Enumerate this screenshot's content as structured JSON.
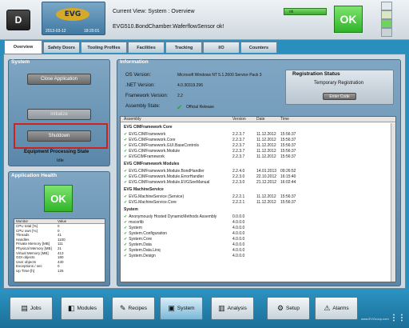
{
  "header": {
    "badge": "D",
    "logo_text": "EVG",
    "date": "2013-03-12",
    "time": "18:20:01",
    "current_view": "Current View: System : Overview",
    "status_message": "EVG510.BondChamber.WaferflowSensor ok!",
    "status_indicator": "ok",
    "ok_label": "OK",
    "colors": {
      "ok_green": "#3daa30",
      "accent_blue": "#2a8fbd"
    }
  },
  "tabs": [
    {
      "label": "Overview",
      "active": true
    },
    {
      "label": "Safety Doors"
    },
    {
      "label": "Tooling Profiles"
    },
    {
      "label": "Facilities"
    },
    {
      "label": "Tracking"
    },
    {
      "label": "I/O"
    },
    {
      "label": "Counters"
    }
  ],
  "system": {
    "title": "System",
    "close_app": "Close Application",
    "initialize": "Initialize",
    "shutdown": "Shutdown",
    "state_label": "Equipment Processing State",
    "state_value": "Idle"
  },
  "health": {
    "title": "Application Health",
    "ok_label": "OK",
    "table_headers": [
      "Monitor",
      "Value"
    ],
    "rows": [
      [
        "CPU total [%]",
        "0"
      ],
      [
        "CPU own [%]",
        "0"
      ],
      [
        "Threads",
        "41"
      ],
      [
        "Handles",
        "1100"
      ],
      [
        "Private Memory [MB]",
        "111"
      ],
      [
        "Physical Memory [MB]",
        "21"
      ],
      [
        "Virtual Memory [MB]",
        "413"
      ],
      [
        "GDI objects",
        "180"
      ],
      [
        "User objects",
        "440"
      ],
      [
        "Exceptions / sec",
        "0"
      ],
      [
        "Up Time [h]",
        "125"
      ]
    ]
  },
  "information": {
    "title": "Information",
    "os_label": "OS Version:",
    "os_value": "Microsoft Windows NT 5.1.2600 Service Pack 3",
    "net_label": ".NET Version:",
    "net_value": "4.0.30319.296",
    "fw_label": "Framework Version:",
    "fw_value": "2.2",
    "assembly_label": "Assembly State:",
    "assembly_value": "Official Release",
    "registration": {
      "title": "Registration Status",
      "text": "Temporary Registration",
      "button": "Enter Code"
    },
    "table_headers": [
      "Assembly",
      "Version",
      "Date",
      "Time"
    ],
    "groups": [
      {
        "name": "EVG CIMFramework Core",
        "rows": [
          [
            "EVG.CIMFramework",
            "2.2.3.7",
            "11.12.2012",
            "15:56:37"
          ],
          [
            "EVG.CIMFramework.Core",
            "2.2.3.7",
            "11.12.2012",
            "15:56:37"
          ],
          [
            "EVG.CIMFramework.GUI.BaseControls",
            "2.2.3.7",
            "11.12.2012",
            "15:56:37"
          ],
          [
            "EVG.CIMFramework.Module",
            "2.2.3.7",
            "11.12.2012",
            "15:56:37"
          ],
          [
            "EVGCIMFramework",
            "2.2.3.7",
            "11.12.2012",
            "15:56:37"
          ]
        ]
      },
      {
        "name": "EVG CIMFramework Modules",
        "rows": [
          [
            "EVG.CIMFramework.Module.BondHandler",
            "2.2.4.0",
            "14.01.2013",
            "09:26:52"
          ],
          [
            "EVG.CIMFramework.Module.ErrorHandler",
            "2.2.3.0",
            "22.10.2012",
            "16:15:40"
          ],
          [
            "EVG.CIMFramework.Module.EVGSeeManual",
            "2.2.3.0",
            "21.12.2012",
            "16:02:44"
          ]
        ]
      },
      {
        "name": "EVG MachineService",
        "rows": [
          [
            "EVG.MachineService (Service)",
            "2.2.2.1",
            "11.12.2012",
            "15:56:37"
          ],
          [
            "EVG.MachineService.Core",
            "2.2.2.1",
            "11.12.2012",
            "15:56:37"
          ]
        ]
      },
      {
        "name": "System",
        "rows": [
          [
            "Anonymously Hosted DynamicMethods Assembly",
            "0.0.0.0",
            "",
            ""
          ],
          [
            "mscorlib",
            "4.0.0.0",
            "",
            ""
          ],
          [
            "System",
            "4.0.0.0",
            "",
            ""
          ],
          [
            "System.Configuration",
            "4.0.0.0",
            "",
            ""
          ],
          [
            "System.Core",
            "4.0.0.0",
            "",
            ""
          ],
          [
            "System.Data",
            "4.0.0.0",
            "",
            ""
          ],
          [
            "System.Data.Linq",
            "4.0.0.0",
            "",
            ""
          ],
          [
            "System.Design",
            "4.0.0.0",
            "",
            ""
          ]
        ]
      }
    ]
  },
  "toolbar": [
    {
      "label": "Jobs",
      "icon": "jobs-icon",
      "glyph": "▤"
    },
    {
      "label": "Modules",
      "icon": "modules-icon",
      "glyph": "◧"
    },
    {
      "label": "Recipes",
      "icon": "recipes-icon",
      "glyph": "✎"
    },
    {
      "label": "System",
      "icon": "system-icon",
      "glyph": "▣",
      "active": true
    },
    {
      "label": "Analysis",
      "icon": "analysis-icon",
      "glyph": "▥"
    },
    {
      "label": "Setup",
      "icon": "setup-icon",
      "glyph": "⚙"
    },
    {
      "label": "Alarms",
      "icon": "alarms-icon",
      "glyph": "⚠"
    }
  ],
  "footer": {
    "site": "www.EVGroup.com"
  }
}
